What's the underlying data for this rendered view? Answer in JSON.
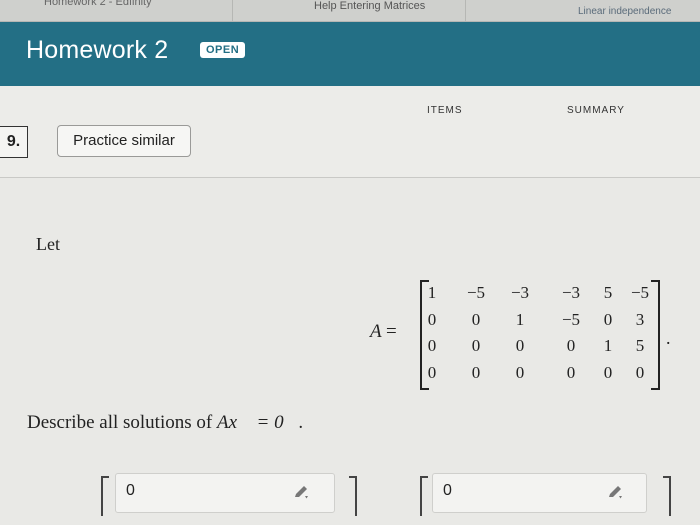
{
  "browser_tabs": [
    {
      "label": "Homework 2 - Edfinity"
    },
    {
      "label": "Help Entering Matrices"
    },
    {
      "label": "Linear independence"
    }
  ],
  "header": {
    "title": "Homework 2",
    "badge": "OPEN",
    "background": "#236f85"
  },
  "subtabs": {
    "items": "ITEMS",
    "summary": "SUMMARY"
  },
  "question": {
    "number": "9.",
    "practice_label": "Practice similar"
  },
  "problem": {
    "intro": "Let",
    "matrix_name": "A",
    "matrix": [
      [
        "1",
        "−5",
        "−3",
        "−3",
        "5",
        "−5"
      ],
      [
        "0",
        "0",
        "1",
        "−5",
        "0",
        "3"
      ],
      [
        "0",
        "0",
        "0",
        "0",
        "1",
        "5"
      ],
      [
        "0",
        "0",
        "0",
        "0",
        "0",
        "0"
      ]
    ],
    "prompt_prefix": "Describe all solutions of ",
    "prompt_math": "Ax⃗ = 0⃗",
    "prompt_suffix": "."
  },
  "answers": [
    {
      "value": "0",
      "edit_icon": "pencil-icon"
    },
    {
      "value": "0",
      "edit_icon": "pencil-icon"
    }
  ]
}
